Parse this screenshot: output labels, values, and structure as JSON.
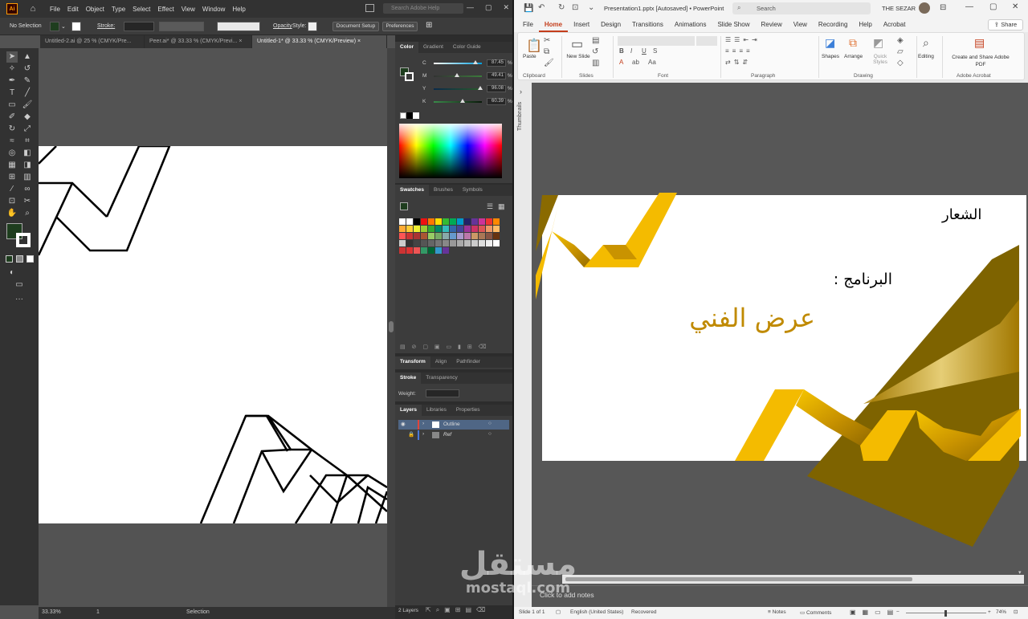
{
  "illustrator": {
    "menu": [
      "File",
      "Edit",
      "Object",
      "Type",
      "Select",
      "Effect",
      "View",
      "Window",
      "Help"
    ],
    "logo": "Ai",
    "search_placeholder": "Search Adobe Help",
    "control": {
      "selection": "No Selection",
      "stroke_label": "Stroke:",
      "opacity_label": "Opacity",
      "style_label": "Style:",
      "doc_setup": "Document Setup",
      "preferences": "Preferences"
    },
    "tabs": [
      {
        "label": "Untitled-2.ai @ 25 % (CMYK/Pre...",
        "close": "×"
      },
      {
        "label": "Peer.ai* @ 33.33 % (CMYK/Previ...",
        "close": "×"
      },
      {
        "label": "Untitled-1* @ 33.33 % (CMYK/Preview)",
        "close": "×"
      }
    ],
    "status": {
      "zoom": "33.33%",
      "artboard": "1",
      "tool": "Selection"
    },
    "panels": {
      "color_tabs": [
        "Color",
        "Gradient",
        "Color Guide"
      ],
      "cmyk": [
        {
          "label": "C",
          "value": "87.45",
          "pct": "%",
          "level": 0.87
        },
        {
          "label": "M",
          "value": "49.41",
          "pct": "%",
          "level": 0.49
        },
        {
          "label": "Y",
          "value": "96.08",
          "pct": "%",
          "level": 0.96
        },
        {
          "label": "K",
          "value": "60.39",
          "pct": "%",
          "level": 0.6
        }
      ],
      "swatch_tabs": [
        "Swatches",
        "Brushes",
        "Symbols"
      ],
      "transform_tabs": [
        "Transform",
        "Align",
        "Pathfinder"
      ],
      "stroke_tabs": [
        "Stroke",
        "Transparency"
      ],
      "weight_label": "Weight:",
      "layer_tabs": [
        "Layers",
        "Libraries",
        "Properties"
      ],
      "layers": [
        {
          "name": "Outline",
          "color": "#e0443a"
        },
        {
          "name": "Ref",
          "color": "#4a78d8"
        }
      ],
      "layers_count": "2 Layers"
    },
    "fill_color": "#1e3d1e"
  },
  "powerpoint": {
    "title": "Presentation1.pptx [Autosaved] • PowerPoint",
    "search": "Search",
    "user": "THE SEZAR",
    "tabs": [
      "File",
      "Home",
      "Insert",
      "Design",
      "Transitions",
      "Animations",
      "Slide Show",
      "Review",
      "View",
      "Recording",
      "Help",
      "Acrobat"
    ],
    "share": "Share",
    "ribbon": {
      "paste": "Paste",
      "new_slide": "New Slide",
      "shapes": "Shapes",
      "arrange": "Arrange",
      "quick_styles": "Quick Styles",
      "editing": "Editing",
      "create_share": "Create and Share Adobe PDF",
      "groups": [
        "Clipboard",
        "Slides",
        "Font",
        "Paragraph",
        "Drawing",
        "Adobe Acrobat"
      ]
    },
    "thumbnails_label": "Thumbnails",
    "slide": {
      "logo_text": "الشعار",
      "program_label": "البرنامج :",
      "program_value": "عرض الفني"
    },
    "notes_placeholder": "Click to add notes",
    "status": {
      "slide": "Slide 1 of 1",
      "language": "English (United States)",
      "recovered": "Recovered",
      "notes": "Notes",
      "comments": "Comments",
      "zoom": "74%"
    },
    "accent": "#c43e1c",
    "gold": "#f4bb00"
  },
  "watermark": {
    "arabic": "مستقل",
    "latin": "mostaql.com"
  }
}
